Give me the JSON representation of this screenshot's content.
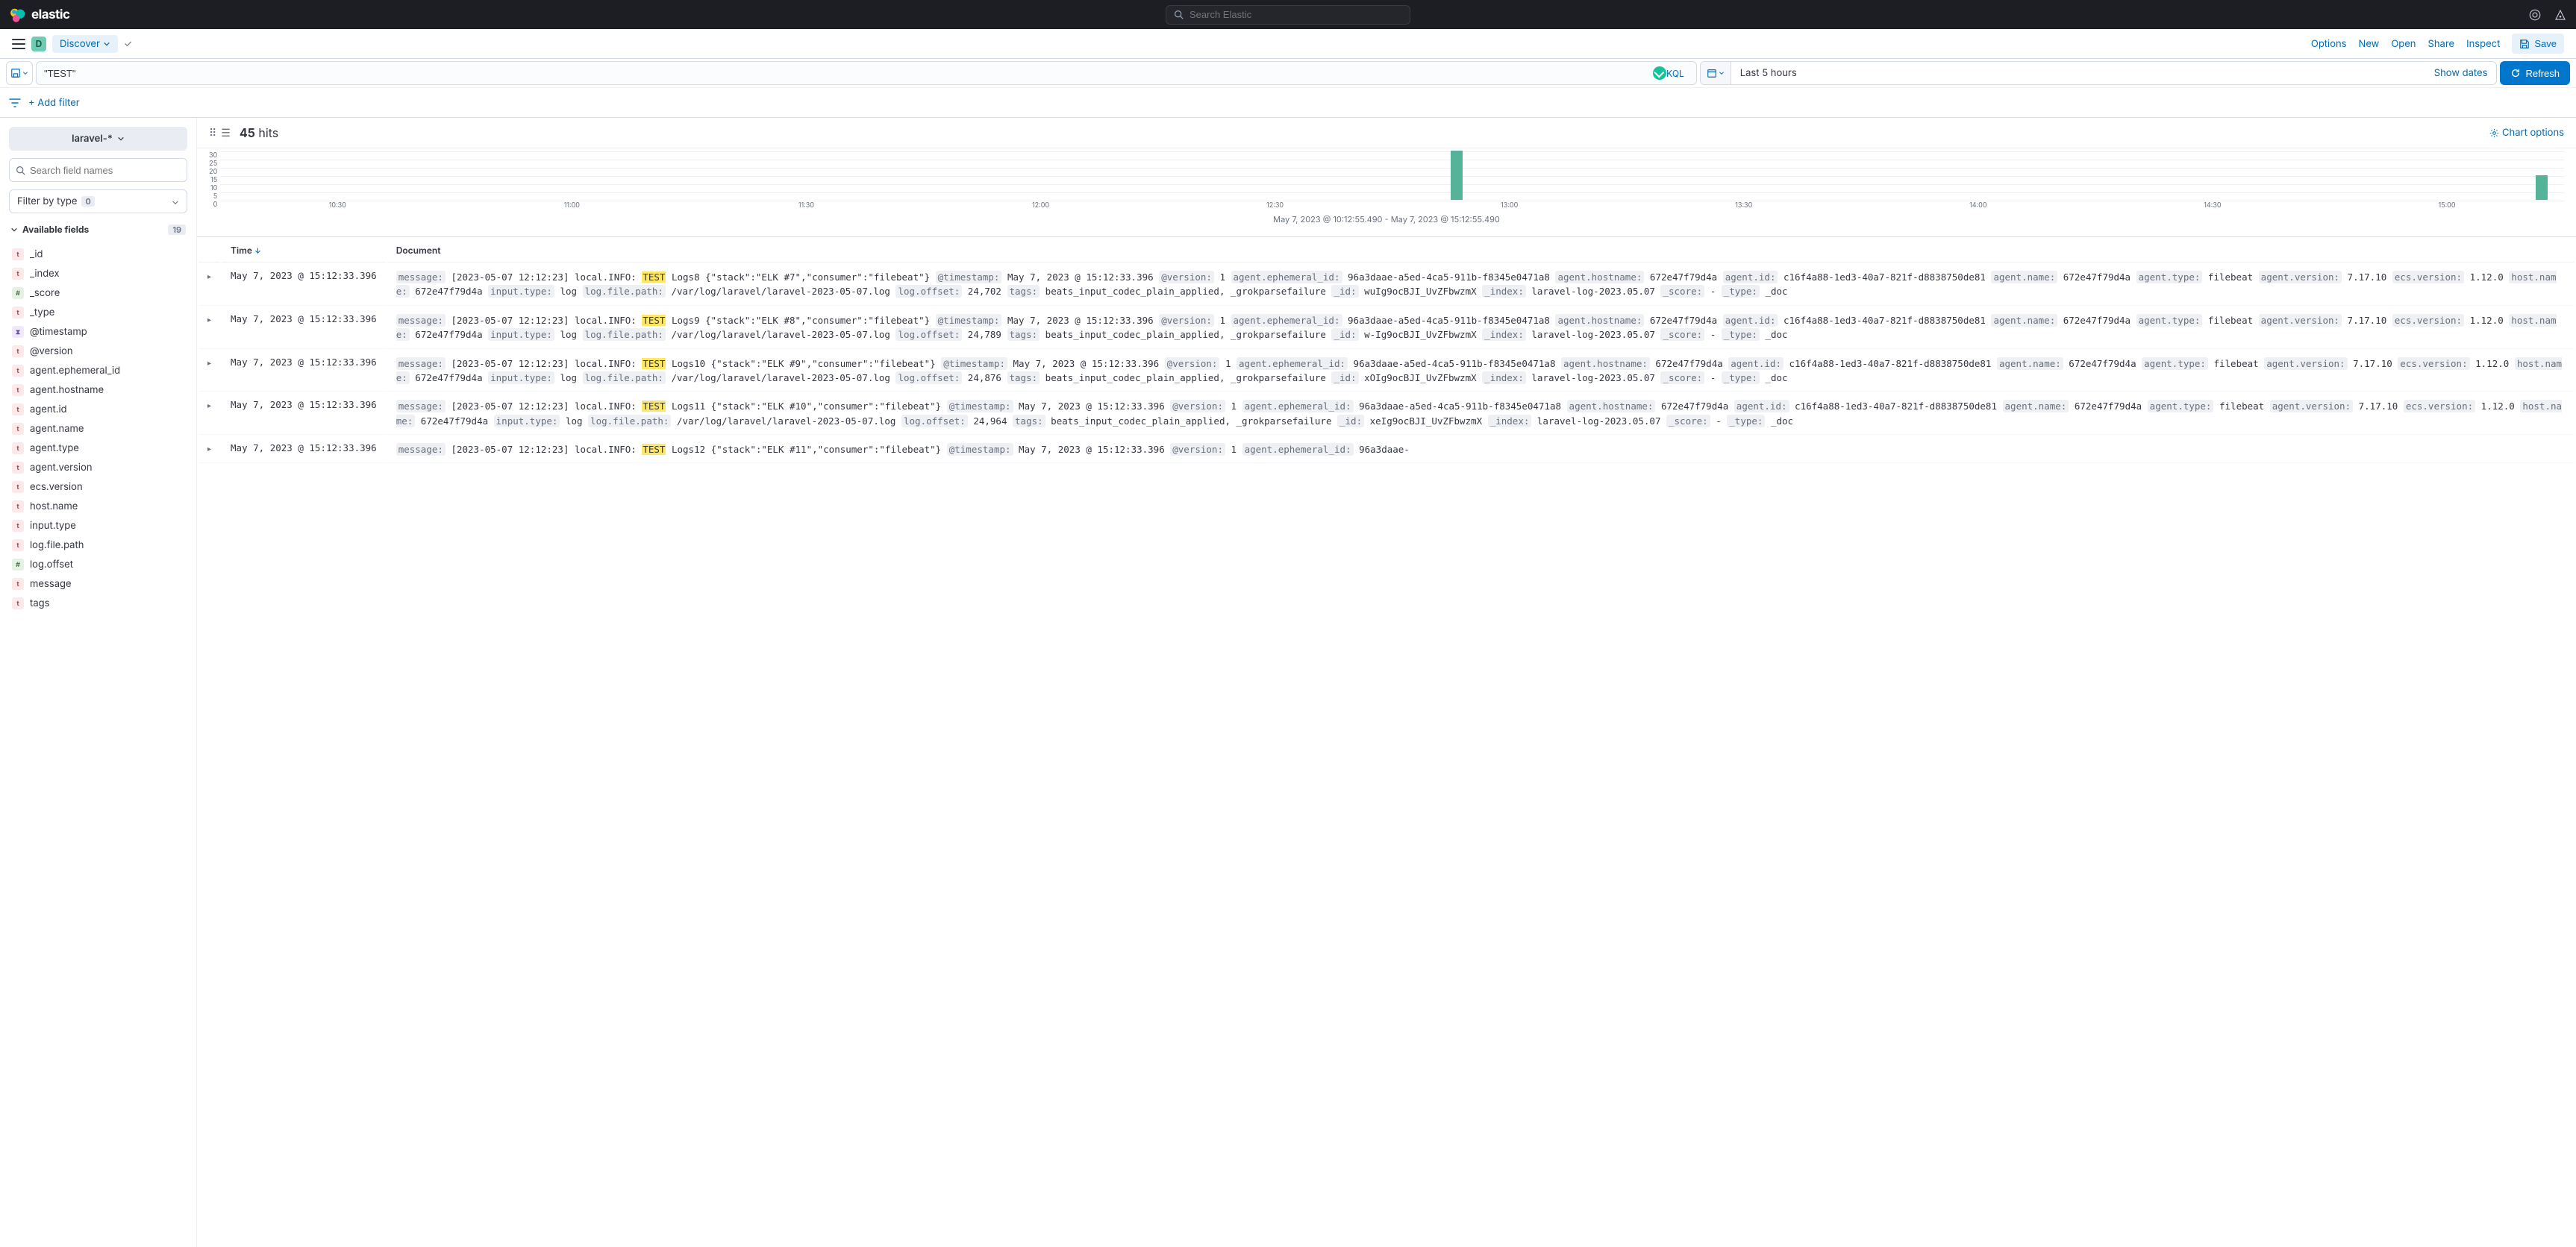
{
  "header": {
    "brand": "elastic",
    "search_placeholder": "Search Elastic"
  },
  "app_bar": {
    "user_initial": "D",
    "app_name": "Discover",
    "links": {
      "options": "Options",
      "new": "New",
      "open": "Open",
      "share": "Share",
      "inspect": "Inspect",
      "save": "Save"
    }
  },
  "query": {
    "value": "\"TEST\"",
    "lang": "KQL",
    "time_range": "Last 5 hours",
    "show_dates": "Show dates",
    "refresh": "Refresh"
  },
  "filters": {
    "add_filter": "+ Add filter"
  },
  "sidebar": {
    "index_pattern": "laravel-*",
    "search_placeholder": "Search field names",
    "type_filter_label": "Filter by type",
    "type_filter_count": "0",
    "available_label": "Available fields",
    "available_count": "19",
    "fields": [
      {
        "type": "t",
        "name": "_id"
      },
      {
        "type": "t",
        "name": "_index"
      },
      {
        "type": "n",
        "name": "_score"
      },
      {
        "type": "t",
        "name": "_type"
      },
      {
        "type": "d",
        "name": "@timestamp"
      },
      {
        "type": "t",
        "name": "@version"
      },
      {
        "type": "t",
        "name": "agent.ephemeral_id"
      },
      {
        "type": "t",
        "name": "agent.hostname"
      },
      {
        "type": "t",
        "name": "agent.id"
      },
      {
        "type": "t",
        "name": "agent.name"
      },
      {
        "type": "t",
        "name": "agent.type"
      },
      {
        "type": "t",
        "name": "agent.version"
      },
      {
        "type": "t",
        "name": "ecs.version"
      },
      {
        "type": "t",
        "name": "host.name"
      },
      {
        "type": "t",
        "name": "input.type"
      },
      {
        "type": "t",
        "name": "log.file.path"
      },
      {
        "type": "n",
        "name": "log.offset"
      },
      {
        "type": "t",
        "name": "message"
      },
      {
        "type": "t",
        "name": "tags"
      }
    ]
  },
  "results": {
    "hit_count": "45",
    "hit_label": "hits",
    "chart_options": "Chart options",
    "headers": {
      "time": "Time",
      "document": "Document"
    }
  },
  "chart_data": {
    "type": "bar",
    "y_ticks": [
      "30",
      "25",
      "20",
      "15",
      "10",
      "5",
      "0"
    ],
    "x_ticks": [
      "10:30",
      "11:00",
      "11:30",
      "12:00",
      "12:30",
      "13:00",
      "13:30",
      "14:00",
      "14:30",
      "15:00"
    ],
    "ylim": [
      0,
      30
    ],
    "bars": [
      {
        "x_pct": 52.5,
        "value": 30
      },
      {
        "x_pct": 98.8,
        "value": 15
      }
    ],
    "caption": "May 7, 2023 @ 10:12:55.490 - May 7, 2023 @ 15:12:55.490"
  },
  "docs": [
    {
      "time": "May 7, 2023 @ 15:12:33.396",
      "msg_pre": "[2023-05-07 12:12:23] local.INFO: ",
      "msg_hl": "TEST",
      "msg_post": " Logs8 {\"stack\":\"ELK #7\",\"consumer\":\"filebeat\"}",
      "timestamp": "May 7, 2023 @ 15:12:33.396",
      "version": "1",
      "eph": "96a3daae-a5ed-4ca5-911b-f8345e0471a8",
      "hostnm": "672e47f79d4a",
      "agentid": "c16f4a88-1ed3-40a7-821f-d8838750de81",
      "agentname": "672e47f79d4a",
      "agenttype": "filebeat",
      "agentver": "7.17.10",
      "ecs": "1.12.0",
      "hostname2": "672e47f79d4a",
      "inputtype": "log",
      "logpath": "/var/log/laravel/laravel-2023-05-07.log",
      "offset": "24,702",
      "tags": "beats_input_codec_plain_applied, _grokparsefailure",
      "id": "wuIg9ocBJI_UvZFbwzmX",
      "index": "laravel-log-2023.05.07",
      "score": "-",
      "type": "_doc"
    },
    {
      "time": "May 7, 2023 @ 15:12:33.396",
      "msg_pre": "[2023-05-07 12:12:23] local.INFO: ",
      "msg_hl": "TEST",
      "msg_post": " Logs9 {\"stack\":\"ELK #8\",\"consumer\":\"filebeat\"}",
      "timestamp": "May 7, 2023 @ 15:12:33.396",
      "version": "1",
      "eph": "96a3daae-a5ed-4ca5-911b-f8345e0471a8",
      "hostnm": "672e47f79d4a",
      "agentid": "c16f4a88-1ed3-40a7-821f-d8838750de81",
      "agentname": "672e47f79d4a",
      "agenttype": "filebeat",
      "agentver": "7.17.10",
      "ecs": "1.12.0",
      "hostname2": "672e47f79d4a",
      "inputtype": "log",
      "logpath": "/var/log/laravel/laravel-2023-05-07.log",
      "offset": "24,789",
      "tags": "beats_input_codec_plain_applied, _grokparsefailure",
      "id": "w-Ig9ocBJI_UvZFbwzmX",
      "index": "laravel-log-2023.05.07",
      "score": "-",
      "type": "_doc"
    },
    {
      "time": "May 7, 2023 @ 15:12:33.396",
      "msg_pre": "[2023-05-07 12:12:23] local.INFO: ",
      "msg_hl": "TEST",
      "msg_post": " Logs10 {\"stack\":\"ELK #9\",\"consumer\":\"filebeat\"}",
      "timestamp": "May 7, 2023 @ 15:12:33.396",
      "version": "1",
      "eph": "96a3daae-a5ed-4ca5-911b-f8345e0471a8",
      "hostnm": "672e47f79d4a",
      "agentid": "c16f4a88-1ed3-40a7-821f-d8838750de81",
      "agentname": "672e47f79d4a",
      "agenttype": "filebeat",
      "agentver": "7.17.10",
      "ecs": "1.12.0",
      "hostname2": "672e47f79d4a",
      "inputtype": "log",
      "logpath": "/var/log/laravel/laravel-2023-05-07.log",
      "offset": "24,876",
      "tags": "beats_input_codec_plain_applied, _grokparsefailure",
      "id": "xOIg9ocBJI_UvZFbwzmX",
      "index": "laravel-log-2023.05.07",
      "score": "-",
      "type": "_doc"
    },
    {
      "time": "May 7, 2023 @ 15:12:33.396",
      "msg_pre": "[2023-05-07 12:12:23] local.INFO: ",
      "msg_hl": "TEST",
      "msg_post": " Logs11 {\"stack\":\"ELK #10\",\"consumer\":\"filebeat\"}",
      "timestamp": "May 7, 2023 @ 15:12:33.396",
      "version": "1",
      "eph": "96a3daae-a5ed-4ca5-911b-f8345e0471a8",
      "hostnm": "672e47f79d4a",
      "agentid": "c16f4a88-1ed3-40a7-821f-d8838750de81",
      "agentname": "672e47f79d4a",
      "agenttype": "filebeat",
      "agentver": "7.17.10",
      "ecs": "1.12.0",
      "hostname2": "672e47f79d4a",
      "inputtype": "log",
      "logpath": "/var/log/laravel/laravel-2023-05-07.log",
      "offset": "24,964",
      "tags": "beats_input_codec_plain_applied, _grokparsefailure",
      "id": "xeIg9ocBJI_UvZFbwzmX",
      "index": "laravel-log-2023.05.07",
      "score": "-",
      "type": "_doc"
    },
    {
      "time": "May 7, 2023 @ 15:12:33.396",
      "msg_pre": "[2023-05-07 12:12:23] local.INFO: ",
      "msg_hl": "TEST",
      "msg_post": " Logs12 {\"stack\":\"ELK #11\",\"consumer\":\"filebeat\"}",
      "timestamp": "May 7, 2023 @ 15:12:33.396",
      "version": "1",
      "eph": "96a3daae-",
      "partial": true
    }
  ]
}
